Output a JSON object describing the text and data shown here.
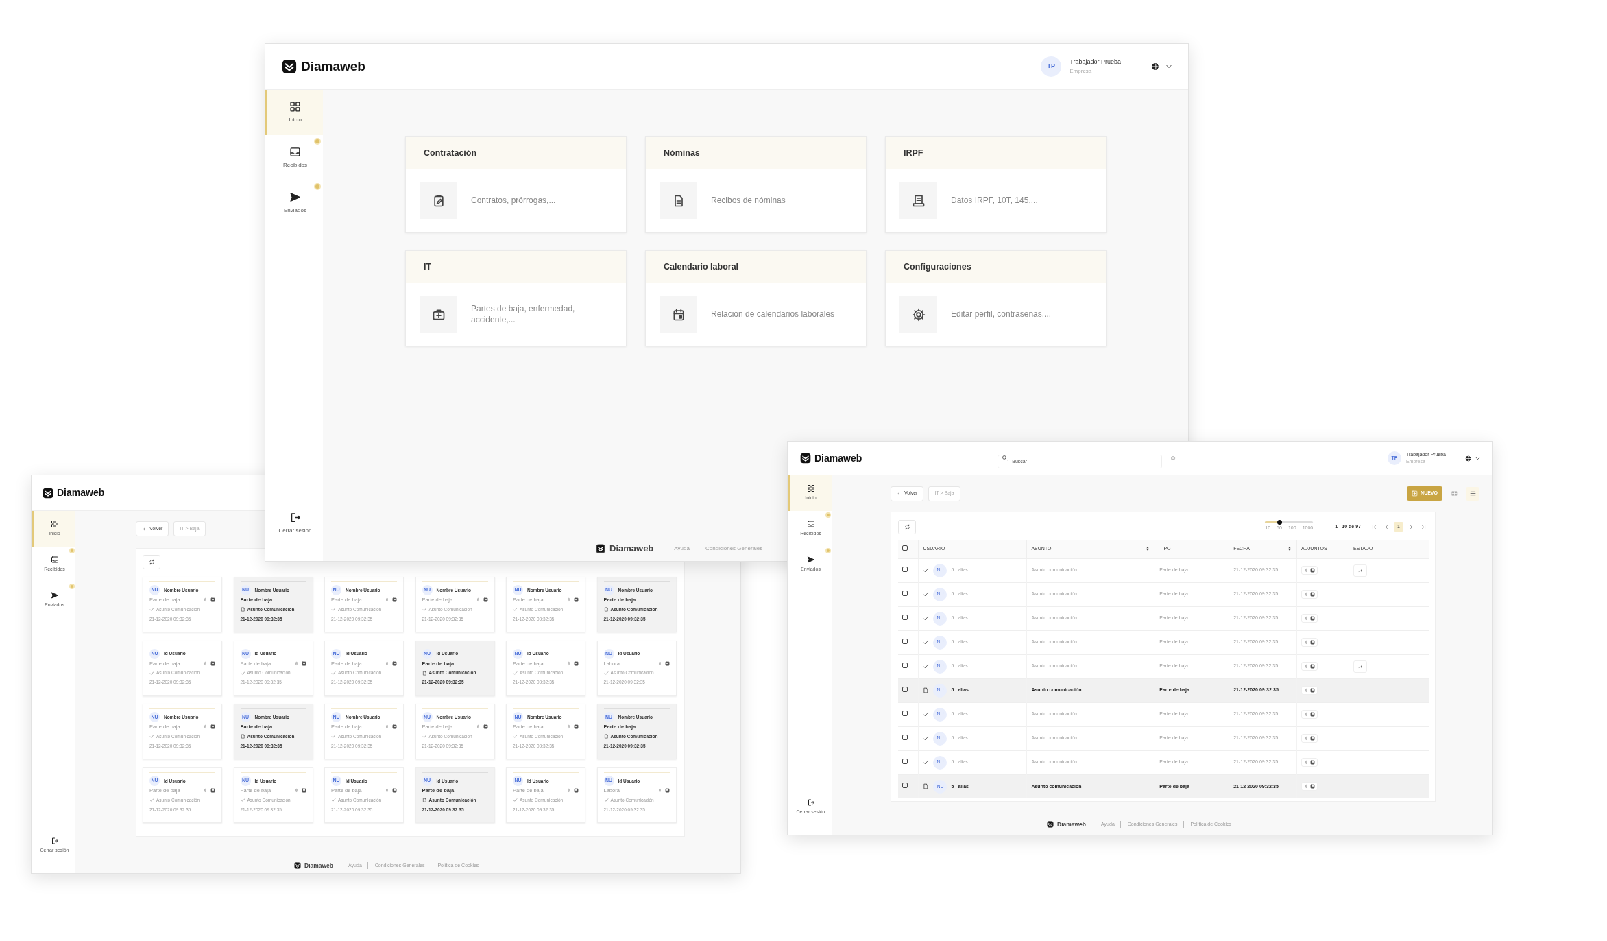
{
  "windows": [
    {
      "kind": "home",
      "brand": "Diamaweb",
      "user": {
        "initials": "TP",
        "name": "Trabajador Prueba",
        "company": "Empresa"
      },
      "sidebar": {
        "items": [
          {
            "label": "Inicio",
            "selected": true,
            "notified": false
          },
          {
            "label": "Recibidos",
            "selected": false,
            "notified": true
          },
          {
            "label": "Enviados",
            "selected": false,
            "notified": true
          }
        ],
        "logout": "Cerrar sesión"
      },
      "sections": [
        {
          "title": "Contratación",
          "text": "Contratos, prórrogas,..."
        },
        {
          "title": "Nóminas",
          "text": "Recibos de nóminas"
        },
        {
          "title": "IRPF",
          "text": "Datos IRPF, 10T, 145,..."
        },
        {
          "title": "IT",
          "text": "Partes de baja, enfermedad, accidente,..."
        },
        {
          "title": "Calendario laboral",
          "text": "Relación de calendarios laborales"
        },
        {
          "title": "Configuraciones",
          "text": "Editar perfil, contraseñas,..."
        }
      ],
      "footer": {
        "brand": "Diamaweb",
        "links": [
          "Ayuda",
          "Condiciones Generales"
        ]
      }
    },
    {
      "kind": "tiles",
      "brand": "Diamaweb",
      "sidebar": {
        "items": [
          {
            "label": "Inicio",
            "selected": true,
            "notified": false
          },
          {
            "label": "Recibidos",
            "selected": false,
            "notified": true
          },
          {
            "label": "Enviados",
            "selected": false,
            "notified": true
          }
        ],
        "logout": "Cerrar sesión"
      },
      "back": "Volver",
      "breadcrumb": "IT > Baja",
      "cards": [
        {
          "initials": "NU",
          "name": "Nombre Usuario",
          "type": "Parte de baja",
          "subject": "Asunto Comunicación",
          "date": "21-12-2020 09:32:35",
          "read": true
        },
        {
          "initials": "NU",
          "name": "Nombre Usuario",
          "type": "Parte de baja",
          "subject": "Asunto Comunicación",
          "date": "21-12-2020 09:32:35",
          "read": false
        },
        {
          "initials": "NU",
          "name": "Nombre Usuario",
          "type": "Parte de baja",
          "subject": "Asunto Comunicación",
          "date": "21-12-2020 09:32:35",
          "read": true
        },
        {
          "initials": "NU",
          "name": "Nombre Usuario",
          "type": "Parte de baja",
          "subject": "Asunto Comunicación",
          "date": "21-12-2020 09:32:35",
          "read": true
        },
        {
          "initials": "NU",
          "name": "Nombre Usuario",
          "type": "Parte de baja",
          "subject": "Asunto Comunicación",
          "date": "21-12-2020 09:32:35",
          "read": true
        },
        {
          "initials": "NU",
          "name": "Nombre Usuario",
          "type": "Parte de baja",
          "subject": "Asunto Comunicación",
          "date": "21-12-2020 09:32:35",
          "read": false
        },
        {
          "initials": "NU",
          "name": "Id Usuario",
          "type": "Parte de baja",
          "subject": "Asunto Comunicación",
          "date": "21-12-2020 09:32:35",
          "read": true
        },
        {
          "initials": "NU",
          "name": "Id Usuario",
          "type": "Parte de baja",
          "subject": "Asunto Comunicación",
          "date": "21-12-2020 09:32:35",
          "read": true
        },
        {
          "initials": "NU",
          "name": "Id Usuario",
          "type": "Parte de baja",
          "subject": "Asunto Comunicación",
          "date": "21-12-2020 09:32:35",
          "read": true
        },
        {
          "initials": "NU",
          "name": "Id Usuario",
          "type": "Parte de baja",
          "subject": "Asunto Comunicación",
          "date": "21-12-2020 09:32:35",
          "read": false
        },
        {
          "initials": "NU",
          "name": "Id Usuario",
          "type": "Parte de baja",
          "subject": "Asunto Comunicación",
          "date": "21-12-2020 09:32:35",
          "read": true
        },
        {
          "initials": "NU",
          "name": "Id Usuario",
          "type": "Laboral",
          "subject": "Asunto Comunicación",
          "date": "21-12-2020 09:32:35",
          "read": true
        },
        {
          "initials": "NU",
          "name": "Nombre Usuario",
          "type": "Parte de baja",
          "subject": "Asunto Comunicación",
          "date": "21-12-2020 09:32:35",
          "read": true
        },
        {
          "initials": "NU",
          "name": "Nombre Usuario",
          "type": "Parte de baja",
          "subject": "Asunto Comunicación",
          "date": "21-12-2020 09:32:35",
          "read": false
        },
        {
          "initials": "NU",
          "name": "Nombre Usuario",
          "type": "Parte de baja",
          "subject": "Asunto Comunicación",
          "date": "21-12-2020 09:32:35",
          "read": true
        },
        {
          "initials": "NU",
          "name": "Nombre Usuario",
          "type": "Parte de baja",
          "subject": "Asunto Comunicación",
          "date": "21-12-2020 09:32:35",
          "read": true
        },
        {
          "initials": "NU",
          "name": "Nombre Usuario",
          "type": "Parte de baja",
          "subject": "Asunto Comunicación",
          "date": "21-12-2020 09:32:35",
          "read": true
        },
        {
          "initials": "NU",
          "name": "Nombre Usuario",
          "type": "Parte de baja",
          "subject": "Asunto Comunicación",
          "date": "21-12-2020 09:32:35",
          "read": false
        },
        {
          "initials": "NU",
          "name": "Id Usuario",
          "type": "Parte de baja",
          "subject": "Asunto Comunicación",
          "date": "21-12-2020 09:32:35",
          "read": true
        },
        {
          "initials": "NU",
          "name": "Id Usuario",
          "type": "Parte de baja",
          "subject": "Asunto Comunicación",
          "date": "21-12-2020 09:32:35",
          "read": true
        },
        {
          "initials": "NU",
          "name": "Id Usuario",
          "type": "Parte de baja",
          "subject": "Asunto Comunicación",
          "date": "21-12-2020 09:32:35",
          "read": true
        },
        {
          "initials": "NU",
          "name": "Id Usuario",
          "type": "Parte de baja",
          "subject": "Asunto Comunicación",
          "date": "21-12-2020 09:32:35",
          "read": false
        },
        {
          "initials": "NU",
          "name": "Id Usuario",
          "type": "Parte de baja",
          "subject": "Asunto Comunicación",
          "date": "21-12-2020 09:32:35",
          "read": true
        },
        {
          "initials": "NU",
          "name": "Id Usuario",
          "type": "Laboral",
          "subject": "Asunto Comunicación",
          "date": "21-12-2020 09:32:35",
          "read": true
        }
      ],
      "footer": {
        "brand": "Diamaweb",
        "links": [
          "Ayuda",
          "Condiciones Generales",
          "Política de Cookies"
        ]
      }
    },
    {
      "kind": "table",
      "brand": "Diamaweb",
      "search": {
        "placeholder": "Buscar"
      },
      "user": {
        "initials": "TP",
        "name": "Trabajador Prueba",
        "company": "Empresa"
      },
      "sidebar": {
        "items": [
          {
            "label": "Inicio",
            "selected": true,
            "notified": false
          },
          {
            "label": "Recibidos",
            "selected": false,
            "notified": true
          },
          {
            "label": "Enviados",
            "selected": false,
            "notified": true
          }
        ],
        "logout": "Cerrar sesión"
      },
      "back": "Volver",
      "breadcrumb": "IT > Baja",
      "new_button": "NUEVO",
      "views": [
        {
          "kind": "grid",
          "selected": false
        },
        {
          "kind": "list",
          "selected": true
        }
      ],
      "page_size": {
        "level": 0.3,
        "ticks": [
          "10",
          "50",
          "100",
          "1000"
        ]
      },
      "pagination": {
        "range": "1 - 10 de 97",
        "pages": [
          {
            "label": "1",
            "selected": true
          }
        ]
      },
      "select_all": {
        "checked": false
      },
      "columns": [
        {
          "label": "USUARIO",
          "sortable": false
        },
        {
          "label": "ASUNTO",
          "sortable": true
        },
        {
          "label": "TIPO",
          "sortable": false
        },
        {
          "label": "FECHA",
          "sortable": true
        },
        {
          "label": "ADJUNTOS",
          "sortable": false
        },
        {
          "label": "ESTADO",
          "sortable": false
        }
      ],
      "rows": [
        {
          "checked": false,
          "read": true,
          "initials": "NU",
          "count": "5",
          "alias": "alias",
          "subject": "Asunto comunicación",
          "type": "Parte de baja",
          "date": "21-12-2020 09:32:35",
          "forwarded": true
        },
        {
          "checked": false,
          "read": true,
          "initials": "NU",
          "count": "5",
          "alias": "alias",
          "subject": "Asunto comunicación",
          "type": "Parte de baja",
          "date": "21-12-2020 09:32:35",
          "forwarded": false
        },
        {
          "checked": false,
          "read": true,
          "initials": "NU",
          "count": "5",
          "alias": "alias",
          "subject": "Asunto comunicación",
          "type": "Parte de baja",
          "date": "21-12-2020 09:32:35",
          "forwarded": false
        },
        {
          "checked": false,
          "read": true,
          "initials": "NU",
          "count": "5",
          "alias": "alias",
          "subject": "Asunto comunicación",
          "type": "Parte de baja",
          "date": "21-12-2020 09:32:35",
          "forwarded": false
        },
        {
          "checked": false,
          "read": true,
          "initials": "NU",
          "count": "5",
          "alias": "alias",
          "subject": "Asunto comunicación",
          "type": "Parte de baja",
          "date": "21-12-2020 09:32:35",
          "forwarded": true
        },
        {
          "checked": false,
          "read": false,
          "initials": "NU",
          "count": "5",
          "alias": "alias",
          "subject": "Asunto comunicación",
          "type": "Parte de baja",
          "date": "21-12-2020 09:32:35",
          "forwarded": false
        },
        {
          "checked": false,
          "read": true,
          "initials": "NU",
          "count": "5",
          "alias": "alias",
          "subject": "Asunto comunicación",
          "type": "Parte de baja",
          "date": "21-12-2020 09:32:35",
          "forwarded": false
        },
        {
          "checked": false,
          "read": true,
          "initials": "NU",
          "count": "5",
          "alias": "alias",
          "subject": "Asunto comunicación",
          "type": "Parte de baja",
          "date": "21-12-2020 09:32:35",
          "forwarded": false
        },
        {
          "checked": false,
          "read": true,
          "initials": "NU",
          "count": "5",
          "alias": "alias",
          "subject": "Asunto comunicación",
          "type": "Parte de baja",
          "date": "21-12-2020 09:32:35",
          "forwarded": false
        },
        {
          "checked": false,
          "read": false,
          "initials": "NU",
          "count": "5",
          "alias": "alias",
          "subject": "Asunto comunicación",
          "type": "Parte de baja",
          "date": "21-12-2020 09:32:35",
          "forwarded": false
        }
      ],
      "footer": {
        "brand": "Diamaweb",
        "links": [
          "Ayuda",
          "Condiciones Generales",
          "Política de Cookies"
        ]
      }
    }
  ]
}
